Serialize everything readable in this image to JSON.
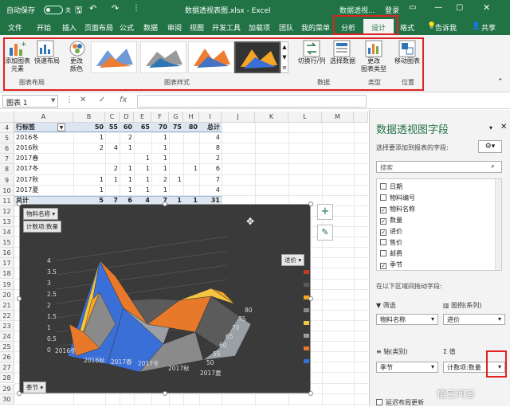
{
  "titlebar": {
    "autosave_label": "自动保存",
    "autosave_state": "关",
    "filename": "数据透视表图.xlsx - Excel",
    "context_title": "数据透视...",
    "login": "登录"
  },
  "tabs": [
    {
      "label": "文件"
    },
    {
      "label": "开始"
    },
    {
      "label": "插入"
    },
    {
      "label": "页面布局"
    },
    {
      "label": "公式"
    },
    {
      "label": "数据"
    },
    {
      "label": "审阅"
    },
    {
      "label": "视图"
    },
    {
      "label": "开发工具"
    },
    {
      "label": "加载项"
    },
    {
      "label": "团队"
    },
    {
      "label": "我的菜单"
    },
    {
      "label": "分析"
    },
    {
      "label": "设计"
    },
    {
      "label": "格式"
    }
  ],
  "tell_me": "告诉我",
  "share": "共享",
  "ribbon": {
    "add_element": "添加图表\n元素",
    "quick_layout": "快速布局",
    "change_colors": "更改\n颜色",
    "group_layouts": "图表布局",
    "group_styles": "图表样式",
    "switch_row_col": "切换行/列",
    "select_data": "选择数据",
    "group_data": "数据",
    "change_type": "更改\n图表类型",
    "group_type": "类型",
    "move_chart": "移动图表",
    "group_location": "位置"
  },
  "formula_bar": {
    "name_box": "图表 1",
    "fx": "fx"
  },
  "columns": [
    "A",
    "B",
    "C",
    "D",
    "E",
    "F",
    "G",
    "H",
    "I",
    "J",
    "K",
    "L",
    "M"
  ],
  "rows": [
    4,
    5,
    6,
    7,
    8,
    9,
    10,
    11,
    12,
    13,
    14,
    15,
    16,
    17,
    18,
    19,
    20,
    21,
    22,
    23,
    24,
    25,
    26,
    27,
    28,
    29,
    30
  ],
  "pivot": {
    "header": [
      "行标签",
      "50",
      "55",
      "60",
      "65",
      "70",
      "75",
      "80",
      "总计"
    ],
    "body": [
      [
        "2016冬",
        "1",
        "",
        "2",
        "",
        "1",
        "",
        "",
        "4"
      ],
      [
        "2016秋",
        "2",
        "4",
        "1",
        "",
        "1",
        "",
        "",
        "8"
      ],
      [
        "2017春",
        "",
        "",
        "",
        "1",
        "1",
        "",
        "",
        "2"
      ],
      [
        "2017冬",
        "",
        "2",
        "1",
        "1",
        "1",
        "",
        "1",
        "6"
      ],
      [
        "2017秋",
        "1",
        "1",
        "1",
        "1",
        "2",
        "1",
        "",
        "7"
      ],
      [
        "2017夏",
        "1",
        "",
        "1",
        "1",
        "1",
        "",
        "",
        "4"
      ]
    ],
    "total": [
      "总计",
      "5",
      "7",
      "6",
      "4",
      "7",
      "1",
      "1",
      "31"
    ]
  },
  "chart": {
    "filter_button": "物料名称",
    "value_button": "计数项:数量",
    "axis_button": "季节",
    "legend_title": "进价",
    "legend": [
      {
        "label": "3.5-4",
        "color": "#c0392b"
      },
      {
        "label": "3-3.5",
        "color": "#5b5b5b"
      },
      {
        "label": "2.5-3",
        "color": "#f5a623"
      },
      {
        "label": "2-2.5",
        "color": "#8a8a8a"
      },
      {
        "label": "1.5-2",
        "color": "#f4c542"
      },
      {
        "label": "1-1.5",
        "color": "#9aa0a6"
      },
      {
        "label": "0.5-1",
        "color": "#e8792b"
      },
      {
        "label": "0-0.5",
        "color": "#3a6fd8"
      }
    ],
    "y_ticks": [
      "4",
      "3.5",
      "3",
      "2.5",
      "2",
      "1.5",
      "1",
      "0.5",
      "0"
    ],
    "x_labels": [
      "2016冬",
      "2016秋",
      "2017春",
      "2017冬",
      "2017秋",
      "2017夏"
    ],
    "z_labels": [
      "80",
      "75",
      "70",
      "65",
      "60",
      "55",
      "50"
    ]
  },
  "panel": {
    "title": "数据透视图字段",
    "subtitle": "选择要添加到报表的字段:",
    "search_placeholder": "搜索",
    "fields": [
      {
        "label": "日期",
        "checked": false
      },
      {
        "label": "物料编号",
        "checked": false
      },
      {
        "label": "物料名称",
        "checked": true
      },
      {
        "label": "数量",
        "checked": true
      },
      {
        "label": "进价",
        "checked": true
      },
      {
        "label": "售价",
        "checked": false
      },
      {
        "label": "邮费",
        "checked": false
      },
      {
        "label": "季节",
        "checked": true
      }
    ],
    "drag_hint": "在以下区域间拖动字段:",
    "filter_label": "筛选",
    "legend_label": "图例(系列)",
    "filter_value": "物料名称",
    "legend_value": "进价",
    "axis_label": "轴(类别)",
    "values_label": "值",
    "axis_value": "季节",
    "values_value": "计数项:数量",
    "defer_label": "延迟布局更新"
  },
  "watermark": "悟空问答"
}
